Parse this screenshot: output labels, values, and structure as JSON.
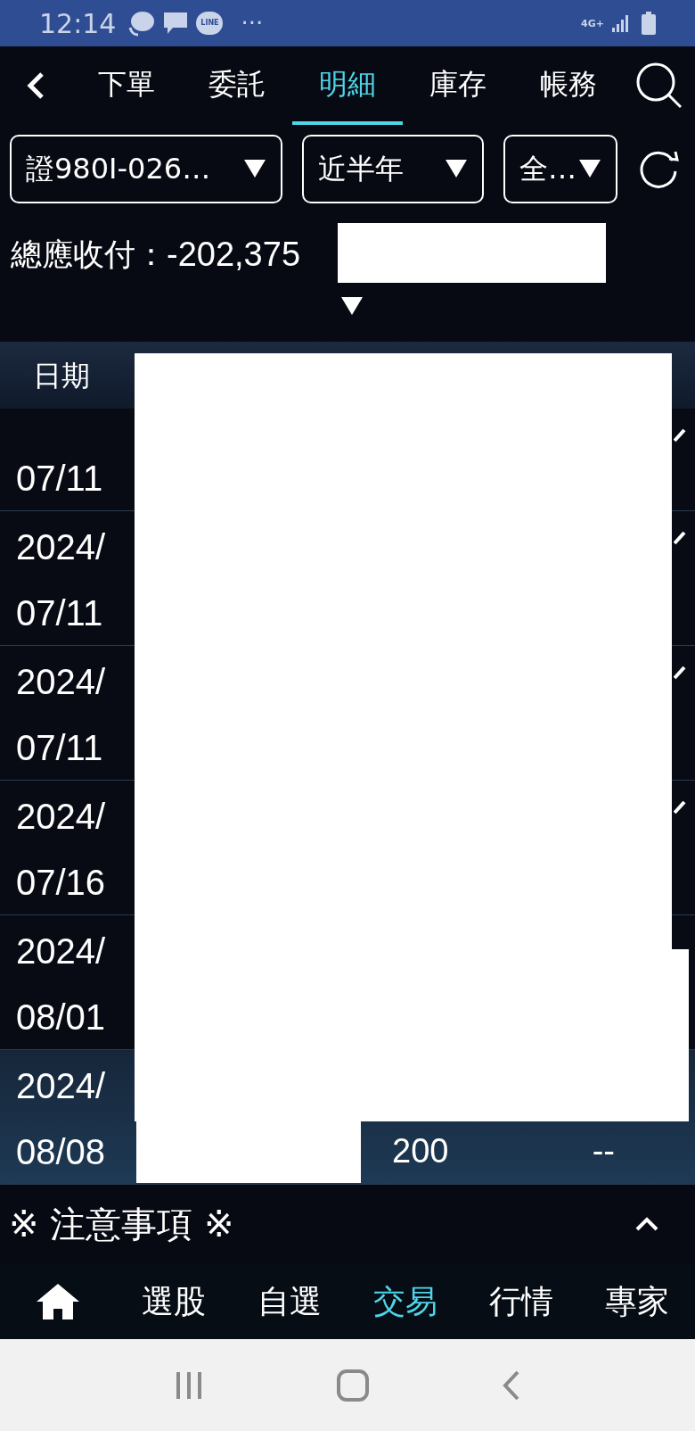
{
  "status_bar": {
    "time": "12:14",
    "more": "···",
    "app_badge": "LINE",
    "network": "4G+"
  },
  "tabs": [
    {
      "label": "下單",
      "selected": false
    },
    {
      "label": "委託",
      "selected": false
    },
    {
      "label": "明細",
      "selected": true
    },
    {
      "label": "庫存",
      "selected": false
    },
    {
      "label": "帳務",
      "selected": false
    }
  ],
  "filters": [
    {
      "label": "證980I-026…"
    },
    {
      "label": "近半年"
    },
    {
      "label": "全…"
    }
  ],
  "summary": {
    "label": "總應收付：",
    "value": "-202,375"
  },
  "table": {
    "columns": [
      {
        "label": "日期"
      }
    ],
    "rows": [
      {
        "date_lines": [
          "07/11"
        ],
        "expandable": true,
        "selected": false,
        "cells": []
      },
      {
        "date_lines": [
          "2024/",
          "07/11"
        ],
        "expandable": true,
        "selected": false,
        "cells": []
      },
      {
        "date_lines": [
          "2024/",
          "07/11"
        ],
        "expandable": true,
        "selected": false,
        "cells": []
      },
      {
        "date_lines": [
          "2024/",
          "07/16"
        ],
        "expandable": true,
        "selected": false,
        "cells": []
      },
      {
        "date_lines": [
          "2024/",
          "08/01"
        ],
        "expandable": false,
        "selected": false,
        "cells": []
      },
      {
        "date_lines": [
          "2024/",
          "08/08"
        ],
        "expandable": false,
        "selected": true,
        "cells": [
          "200",
          "--"
        ]
      }
    ]
  },
  "notice": {
    "title": "※ 注意事項 ※",
    "expanded": false
  },
  "bottom_nav": [
    {
      "kind": "home",
      "selected": false
    },
    {
      "label": "選股",
      "selected": false
    },
    {
      "label": "自選",
      "selected": false
    },
    {
      "label": "交易",
      "selected": true
    },
    {
      "label": "行情",
      "selected": false
    },
    {
      "label": "專家",
      "selected": false
    }
  ]
}
